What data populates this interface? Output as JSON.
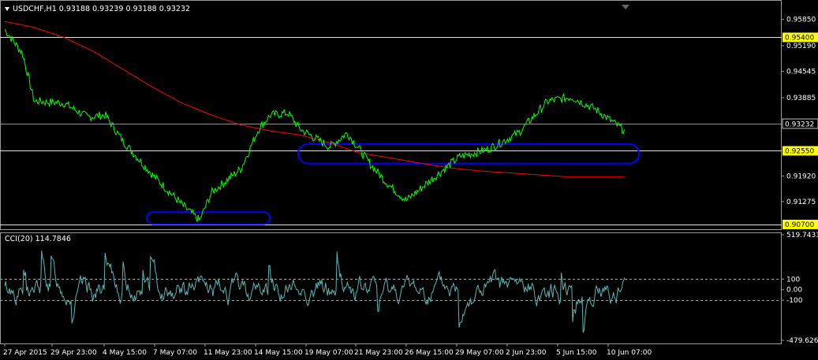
{
  "chart_data": [
    {
      "type": "line",
      "symbol": "USDCHF,H1",
      "ohlc": [
        "0.93188",
        "0.93239",
        "0.93188",
        "0.93232"
      ],
      "ylim": [
        0.906,
        0.9622
      ],
      "price_ticks": [
        "0.95850",
        "0.95190",
        "0.94545",
        "0.93885",
        "0.91920",
        "0.91275"
      ],
      "current_price": "0.93232",
      "horizontal_levels": [
        {
          "label": "0.95400",
          "value": 0.954,
          "color": "#FFFF00"
        },
        {
          "label": "0.92550",
          "value": 0.9255,
          "color": "#FFFF00"
        },
        {
          "label": "0.90700",
          "value": 0.907,
          "color": "#FFFF00"
        }
      ],
      "x_labels": [
        "27 Apr 2015",
        "29 Apr 23:00",
        "4 May 15:00",
        "7 May 07:00",
        "11 May 23:00",
        "14 May 15:00",
        "19 May 07:00",
        "21 May 23:00",
        "26 May 15:00",
        "29 May 07:00",
        "2 Jun 23:00",
        "5 Jun 15:00",
        "10 Jun 07:00"
      ],
      "series": [
        {
          "color": "#00FF00",
          "x": [
            0,
            3,
            5,
            10,
            14,
            17,
            20,
            25,
            30,
            33,
            35,
            40,
            43,
            45,
            48,
            50,
            55,
            58,
            62,
            65,
            68,
            72,
            77,
            82,
            87,
            92,
            96,
            100,
            105
          ],
          "values": [
            0.956,
            0.95,
            0.938,
            0.9375,
            0.934,
            0.9345,
            0.928,
            0.9195,
            0.912,
            0.908,
            0.915,
            0.921,
            0.931,
            0.9345,
            0.935,
            0.931,
            0.9265,
            0.93,
            0.922,
            0.917,
            0.913,
            0.918,
            0.924,
            0.926,
            0.93,
            0.938,
            0.939,
            0.936,
            0.9305
          ]
        },
        {
          "color": "#FF0000",
          "x": [
            0,
            5,
            10,
            15,
            20,
            25,
            30,
            35,
            40,
            45,
            50,
            55,
            60,
            65,
            70,
            75,
            80,
            85,
            90,
            95,
            100,
            105
          ],
          "values": [
            0.958,
            0.9565,
            0.954,
            0.9505,
            0.946,
            0.9415,
            0.9375,
            0.9345,
            0.932,
            0.9305,
            0.9295,
            0.9275,
            0.925,
            0.9238,
            0.9225,
            0.9213,
            0.9205,
            0.92,
            0.9195,
            0.919,
            0.919,
            0.919
          ]
        }
      ],
      "annotations": [
        {
          "shape": "ellipse",
          "color": "#0000FF",
          "x_range": [
            186,
            342
          ],
          "y_range": [
            0.9071,
            0.9101
          ]
        },
        {
          "shape": "ellipse",
          "color": "#0000FF",
          "x_range": [
            378,
            810
          ],
          "y_range": [
            0.9223,
            0.9272
          ]
        }
      ]
    },
    {
      "type": "line",
      "indicator": "CCI(20)",
      "current_value": "114.7846",
      "ylim": [
        -479.6265,
        519.7431
      ],
      "y_ticks": [
        "519.7431",
        "100",
        "0.00",
        "-100",
        "-479.6265"
      ],
      "levels": [
        100,
        -100
      ],
      "series": [
        {
          "color": "#5FB3B3"
        }
      ]
    }
  ]
}
